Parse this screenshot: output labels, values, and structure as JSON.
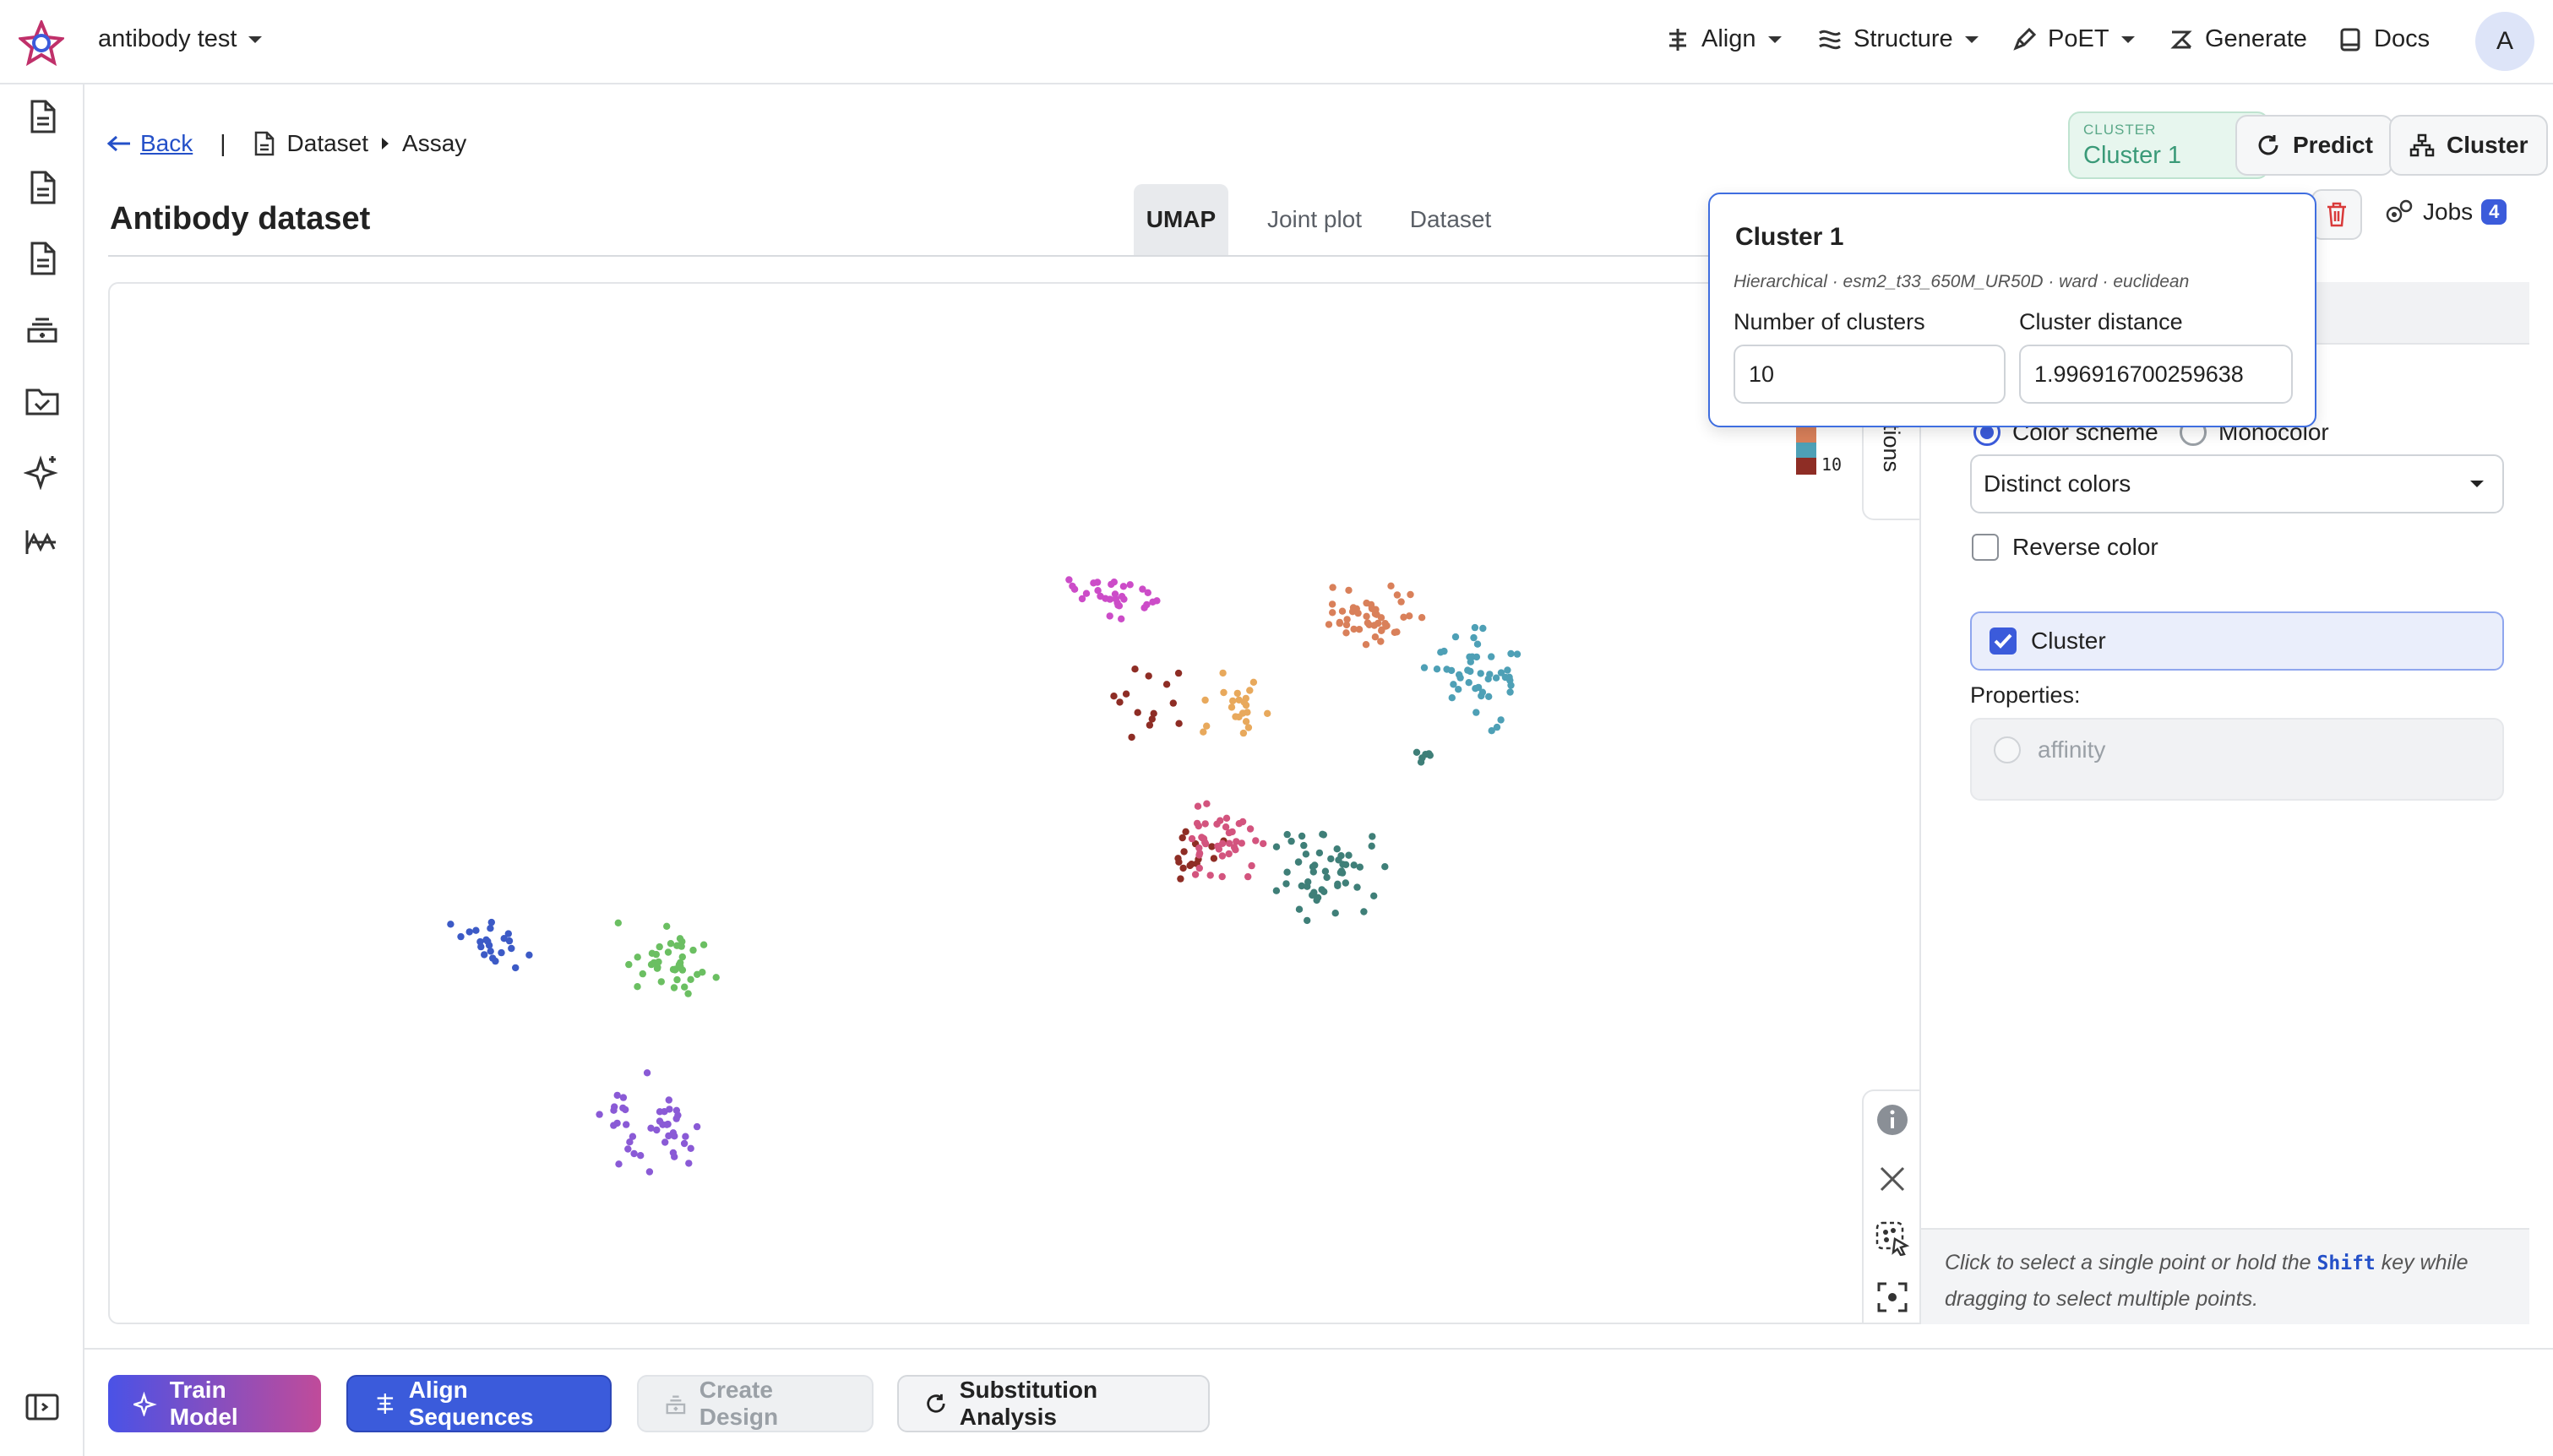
{
  "topbar": {
    "project_name": "antibody test",
    "nav": [
      {
        "label": "Align"
      },
      {
        "label": "Structure"
      },
      {
        "label": "PoET"
      },
      {
        "label": "Generate"
      },
      {
        "label": "Docs"
      }
    ],
    "avatar_initial": "A"
  },
  "breadcrumb": {
    "back": "Back",
    "separator": "|",
    "dataset": "Dataset",
    "assay": "Assay"
  },
  "page_title": "Antibody dataset",
  "tabs": [
    {
      "label": "UMAP",
      "active": true
    },
    {
      "label": "Joint plot",
      "active": false
    },
    {
      "label": "Dataset",
      "active": false
    }
  ],
  "cluster_chip": {
    "caption": "CLUSTER",
    "value": "Cluster 1"
  },
  "actions": {
    "predict": "Predict",
    "cluster": "Cluster",
    "jobs": "Jobs",
    "jobs_count": "4"
  },
  "popup": {
    "title": "Cluster 1",
    "meta": "Hierarchical · esm2_t33_650M_UR50D · ward · euclidean",
    "num_clusters_label": "Number of clusters",
    "num_clusters_value": "10",
    "distance_label": "Cluster distance",
    "distance_value": "1.996916700259638"
  },
  "legend": {
    "last_label": "10",
    "side_tab": "tions"
  },
  "panel": {
    "color_scheme_label": "Color scheme",
    "monocolor_label": "Monocolor",
    "palette_value": "Distinct colors",
    "reverse_label": "Reverse color",
    "cluster_label": "Cluster",
    "properties_label": "Properties:",
    "property_item": "affinity",
    "hint_prefix": "Click to select a single point or hold the ",
    "hint_key": "Shift",
    "hint_suffix": " key while dragging to select multiple points."
  },
  "bottom": {
    "train": "Train Model",
    "align": "Align Sequences",
    "design": "Create Design",
    "substitution": "Substitution Analysis"
  },
  "colors": {
    "accent_blue": "#3b5bdb",
    "train_gradient_start": "#4a52e6",
    "train_gradient_end": "#c04b9a",
    "chip_green": "#3a9a78",
    "delete_red": "#d93a3a"
  },
  "scatter": {
    "clusters": [
      {
        "color": "#3c5ac6"
      },
      {
        "color": "#6bbf62"
      },
      {
        "color": "#8a5ad6"
      },
      {
        "color": "#cc4cc8"
      },
      {
        "color": "#8e2d25"
      },
      {
        "color": "#e8a95c"
      },
      {
        "color": "#d9805a"
      },
      {
        "color": "#4ea0b6"
      },
      {
        "color": "#d3547e"
      },
      {
        "color": "#3f7f78"
      }
    ]
  }
}
